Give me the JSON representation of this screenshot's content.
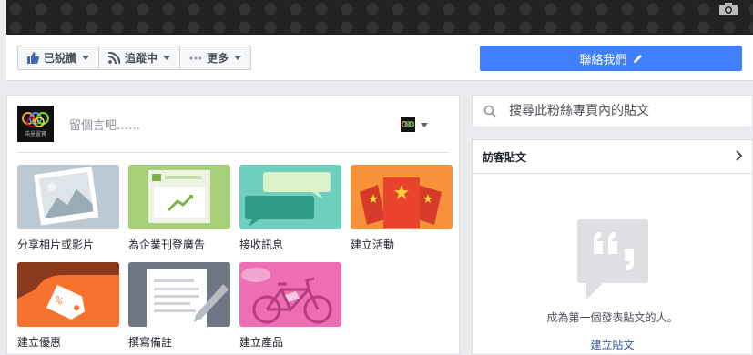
{
  "header": {
    "liked_label": "已說讚",
    "following_label": "追蹤中",
    "more_label": "更多",
    "contact_label": "聯絡我們"
  },
  "composer": {
    "placeholder": "留個言吧……",
    "avatar_text": "諾曼靈寶",
    "tiles": [
      {
        "label": "分享相片或影片"
      },
      {
        "label": "為企業刊登廣告"
      },
      {
        "label": "接收訊息"
      },
      {
        "label": "建立活動"
      },
      {
        "label": "建立優惠"
      },
      {
        "label": "撰寫備註"
      },
      {
        "label": "建立產品"
      }
    ]
  },
  "sidebar": {
    "search_placeholder": "搜尋此粉絲專頁內的貼文",
    "visitor_title": "訪客貼文",
    "empty_message": "成為第一個發表貼文的人。",
    "create_post_label": "建立貼文"
  },
  "colors": {
    "accent": "#4080ff",
    "link": "#365899",
    "background": "#e9ebee"
  }
}
